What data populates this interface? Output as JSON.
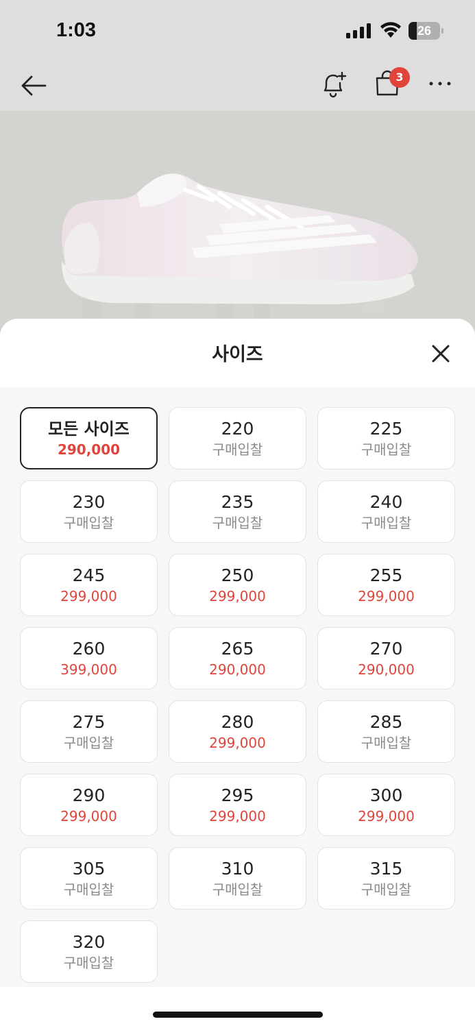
{
  "status_bar": {
    "time": "1:03",
    "battery": "26",
    "battery_level": 0.26
  },
  "nav": {
    "back_icon": "arrow-left-icon",
    "alert_icon": "bell-plus-icon",
    "bag_icon": "shopping-bag-icon",
    "bag_count": "3",
    "more_icon": "more-horizontal-icon"
  },
  "colors": {
    "price_red": "#e0443a",
    "bid_gray": "#8a8a8a",
    "badge_red": "#e0443a"
  },
  "sheet": {
    "title": "사이즈",
    "close_icon": "close-icon"
  },
  "sizes": [
    {
      "label": "모든 사이즈",
      "price": "290,000",
      "selected": true
    },
    {
      "label": "220",
      "price": "구매입찰"
    },
    {
      "label": "225",
      "price": "구매입찰"
    },
    {
      "label": "230",
      "price": "구매입찰"
    },
    {
      "label": "235",
      "price": "구매입찰"
    },
    {
      "label": "240",
      "price": "구매입찰"
    },
    {
      "label": "245",
      "price": "299,000"
    },
    {
      "label": "250",
      "price": "299,000"
    },
    {
      "label": "255",
      "price": "299,000"
    },
    {
      "label": "260",
      "price": "399,000"
    },
    {
      "label": "265",
      "price": "290,000"
    },
    {
      "label": "270",
      "price": "290,000"
    },
    {
      "label": "275",
      "price": "구매입찰"
    },
    {
      "label": "280",
      "price": "299,000"
    },
    {
      "label": "285",
      "price": "구매입찰"
    },
    {
      "label": "290",
      "price": "299,000"
    },
    {
      "label": "295",
      "price": "299,000"
    },
    {
      "label": "300",
      "price": "299,000"
    },
    {
      "label": "305",
      "price": "구매입찰"
    },
    {
      "label": "310",
      "price": "구매입찰"
    },
    {
      "label": "315",
      "price": "구매입찰"
    },
    {
      "label": "320",
      "price": "구매입찰"
    }
  ]
}
